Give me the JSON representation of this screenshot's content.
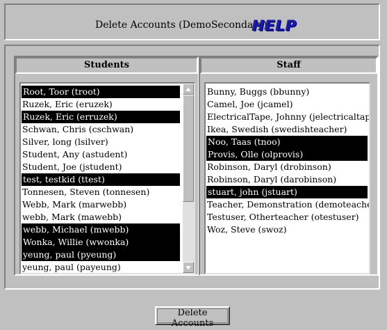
{
  "header": {
    "title": "Delete Accounts (DemoSecondary)",
    "help_label": "HELP"
  },
  "students": {
    "header": "Students",
    "items": [
      {
        "label": "Root, Toor (troot)",
        "selected": true
      },
      {
        "label": "Ruzek, Eric (eruzek)",
        "selected": false
      },
      {
        "label": "Ruzek, Eric (erruzek)",
        "selected": true
      },
      {
        "label": "Schwan, Chris (cschwan)",
        "selected": false
      },
      {
        "label": "Silver, long (lsilver)",
        "selected": false
      },
      {
        "label": "Student, Any (astudent)",
        "selected": false
      },
      {
        "label": "Student, Joe (jstudent)",
        "selected": false
      },
      {
        "label": "test, testkid (ttest)",
        "selected": true
      },
      {
        "label": "Tonnesen, Steven (tonnesen)",
        "selected": false
      },
      {
        "label": "Webb, Mark (marwebb)",
        "selected": false
      },
      {
        "label": "webb, Mark (mawebb)",
        "selected": false
      },
      {
        "label": "webb, Michael (mwebb)",
        "selected": true
      },
      {
        "label": "Wonka, Willie (wwonka)",
        "selected": true
      },
      {
        "label": "yeung, paul (pyeung)",
        "selected": true
      },
      {
        "label": "yeung, paul (payeung)",
        "selected": false
      }
    ]
  },
  "staff": {
    "header": "Staff",
    "items": [
      {
        "label": "Bunny, Buggs (bbunny)",
        "selected": false
      },
      {
        "label": "Camel, Joe (jcamel)",
        "selected": false
      },
      {
        "label": "ElectricalTape, Johnny (jelectricaltape)",
        "selected": false
      },
      {
        "label": "Ikea, Swedish (swedishteacher)",
        "selected": false
      },
      {
        "label": "Noo, Taas (tnoo)",
        "selected": true
      },
      {
        "label": "Provis, Olle (olprovis)",
        "selected": true
      },
      {
        "label": "Robinson, Daryl (drobinson)",
        "selected": false
      },
      {
        "label": "Robinson, Daryl (darobinson)",
        "selected": false
      },
      {
        "label": "stuart, john (jstuart)",
        "selected": true
      },
      {
        "label": "Teacher, Demonstration (demoteacher)",
        "selected": false
      },
      {
        "label": "Testuser, Otherteacher (otestuser)",
        "selected": false
      },
      {
        "label": "Woz, Steve (swoz)",
        "selected": false
      }
    ]
  },
  "actions": {
    "delete_label": "Delete Accounts"
  },
  "colors": {
    "background": "#c0c0c0",
    "selection": "#000000",
    "help_link": "#1a1aa0"
  },
  "icons": {
    "scroll_up": "up-arrow-icon",
    "scroll_down": "down-arrow-icon"
  }
}
